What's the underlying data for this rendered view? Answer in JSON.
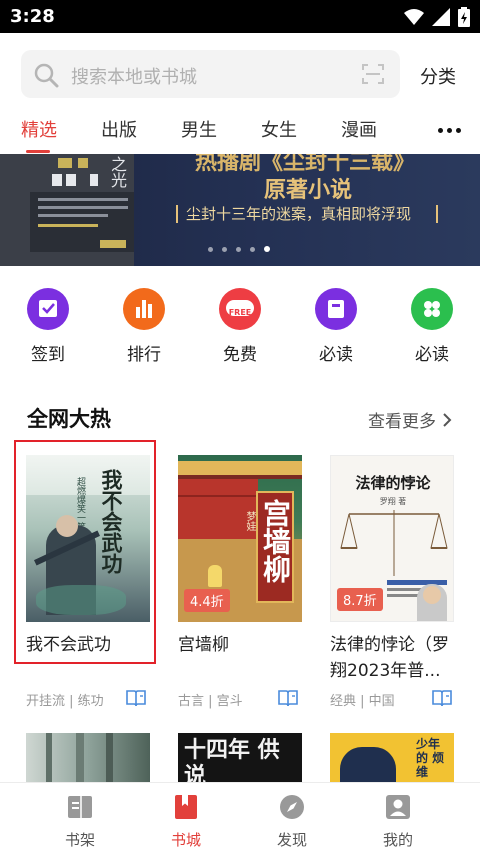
{
  "status": {
    "time": "3:28"
  },
  "search": {
    "placeholder": "搜索本地或书城",
    "classify": "分类"
  },
  "tabs": [
    {
      "label": "精选",
      "active": true
    },
    {
      "label": "出版"
    },
    {
      "label": "男生"
    },
    {
      "label": "女生"
    },
    {
      "label": "漫画"
    }
  ],
  "banner": {
    "title_top": "热播剧《尘封十三载》",
    "title": "原著小说",
    "subtitle": "尘封十三年的迷案，真相即将浮现",
    "book_corner": "之光",
    "dot_count": 5,
    "active_dot": 4
  },
  "quick_entries": [
    {
      "label": "签到",
      "icon": "check-calendar-icon",
      "color": "#7b2fe0"
    },
    {
      "label": "排行",
      "icon": "bar-chart-icon",
      "color": "#f26a1b"
    },
    {
      "label": "免费",
      "icon": "free-icon",
      "icon_text": "FREE",
      "color": "#ee3d43"
    },
    {
      "label": "必读",
      "icon": "bookmark-card-icon",
      "color": "#7b2fe0"
    },
    {
      "label": "必读",
      "icon": "four-petal-icon",
      "color": "#2bbf4e"
    }
  ],
  "section": {
    "title": "全网大热",
    "more": "查看更多"
  },
  "books": [
    {
      "title": "我不会武功",
      "tags": "开挂流 | 练功",
      "cover_text": "我不会武功",
      "cover_sub": "超燃爆笑一笑"
    },
    {
      "title": "宫墙柳",
      "tags": "古言 | 宫斗",
      "cover_text": "宫墙柳",
      "cover_author": "梦娃",
      "price": "4.4折"
    },
    {
      "title": "法律的悖论（罗翔2023年普...",
      "tags": "经典 | 中国",
      "cover_text": "法律的悖论",
      "cover_author": "罗翔 著",
      "price": "8.7折"
    }
  ],
  "next_row": {
    "cover2_text": "十四年 供说",
    "cover3_text": "少年 的 烦 维"
  },
  "nav": [
    {
      "label": "书架",
      "icon": "bookshelf-icon"
    },
    {
      "label": "书城",
      "icon": "bookstore-icon",
      "active": true
    },
    {
      "label": "发现",
      "icon": "compass-icon"
    },
    {
      "label": "我的",
      "icon": "profile-icon"
    }
  ],
  "colors": {
    "accent": "#e2403b",
    "highlight": "#e2222a"
  }
}
